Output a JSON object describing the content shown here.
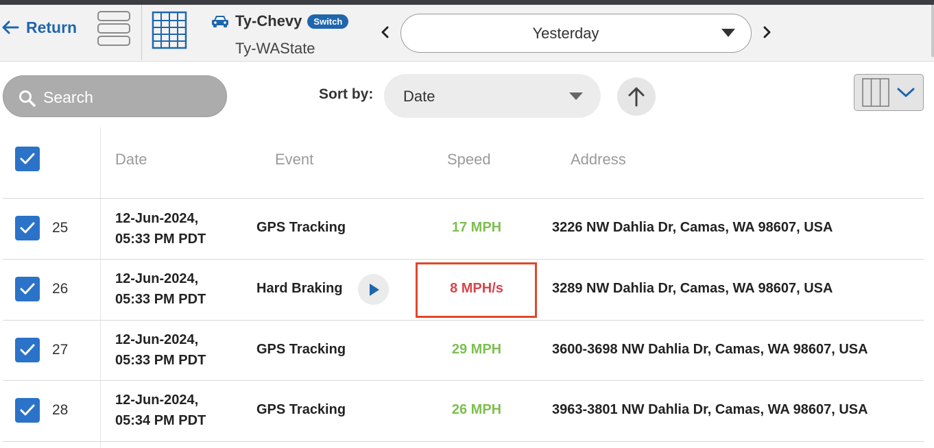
{
  "header": {
    "return_label": "Return",
    "vehicle_name": "Ty-Chevy",
    "switch_label": "Switch",
    "vehicle_group": "Ty-WAState",
    "date_range": "Yesterday"
  },
  "toolbar": {
    "search_placeholder": "Search",
    "sort_label": "Sort by:",
    "sort_value": "Date"
  },
  "table": {
    "columns": [
      "Date",
      "Event",
      "Speed",
      "Address"
    ],
    "rows": [
      {
        "num": "25",
        "date1": "12-Jun-2024,",
        "date2": "05:33 PM PDT",
        "event": "GPS Tracking",
        "speed": "17 MPH",
        "address": "3226 NW Dahlia Dr, Camas, WA 98607, USA"
      },
      {
        "num": "26",
        "date1": "12-Jun-2024,",
        "date2": "05:33 PM PDT",
        "event": "Hard Braking",
        "speed": "8 MPH/s",
        "address": "3289 NW Dahlia Dr, Camas, WA 98607, USA"
      },
      {
        "num": "27",
        "date1": "12-Jun-2024,",
        "date2": "05:33 PM PDT",
        "event": "GPS Tracking",
        "speed": "29 MPH",
        "address": "3600-3698 NW Dahlia Dr, Camas, WA 98607, USA"
      },
      {
        "num": "28",
        "date1": "12-Jun-2024,",
        "date2": "05:34 PM PDT",
        "event": "GPS Tracking",
        "speed": "26 MPH",
        "address": "3963-3801 NW Dahlia Dr, Camas, WA 98607, USA"
      }
    ]
  },
  "colors": {
    "accent": "#1f66ad",
    "checkbox": "#2b72c9",
    "speed_normal": "#7cbf4f",
    "speed_alert": "#d9434a",
    "highlight": "#e0472b"
  },
  "icons": [
    "back-arrow-icon",
    "list-view-icon",
    "grid-view-icon",
    "car-icon",
    "chevron-left-icon",
    "chevron-right-icon",
    "caret-down-icon",
    "search-icon",
    "arrow-up-icon",
    "columns-icon",
    "chevron-down-icon",
    "checkmark-icon",
    "play-icon"
  ]
}
